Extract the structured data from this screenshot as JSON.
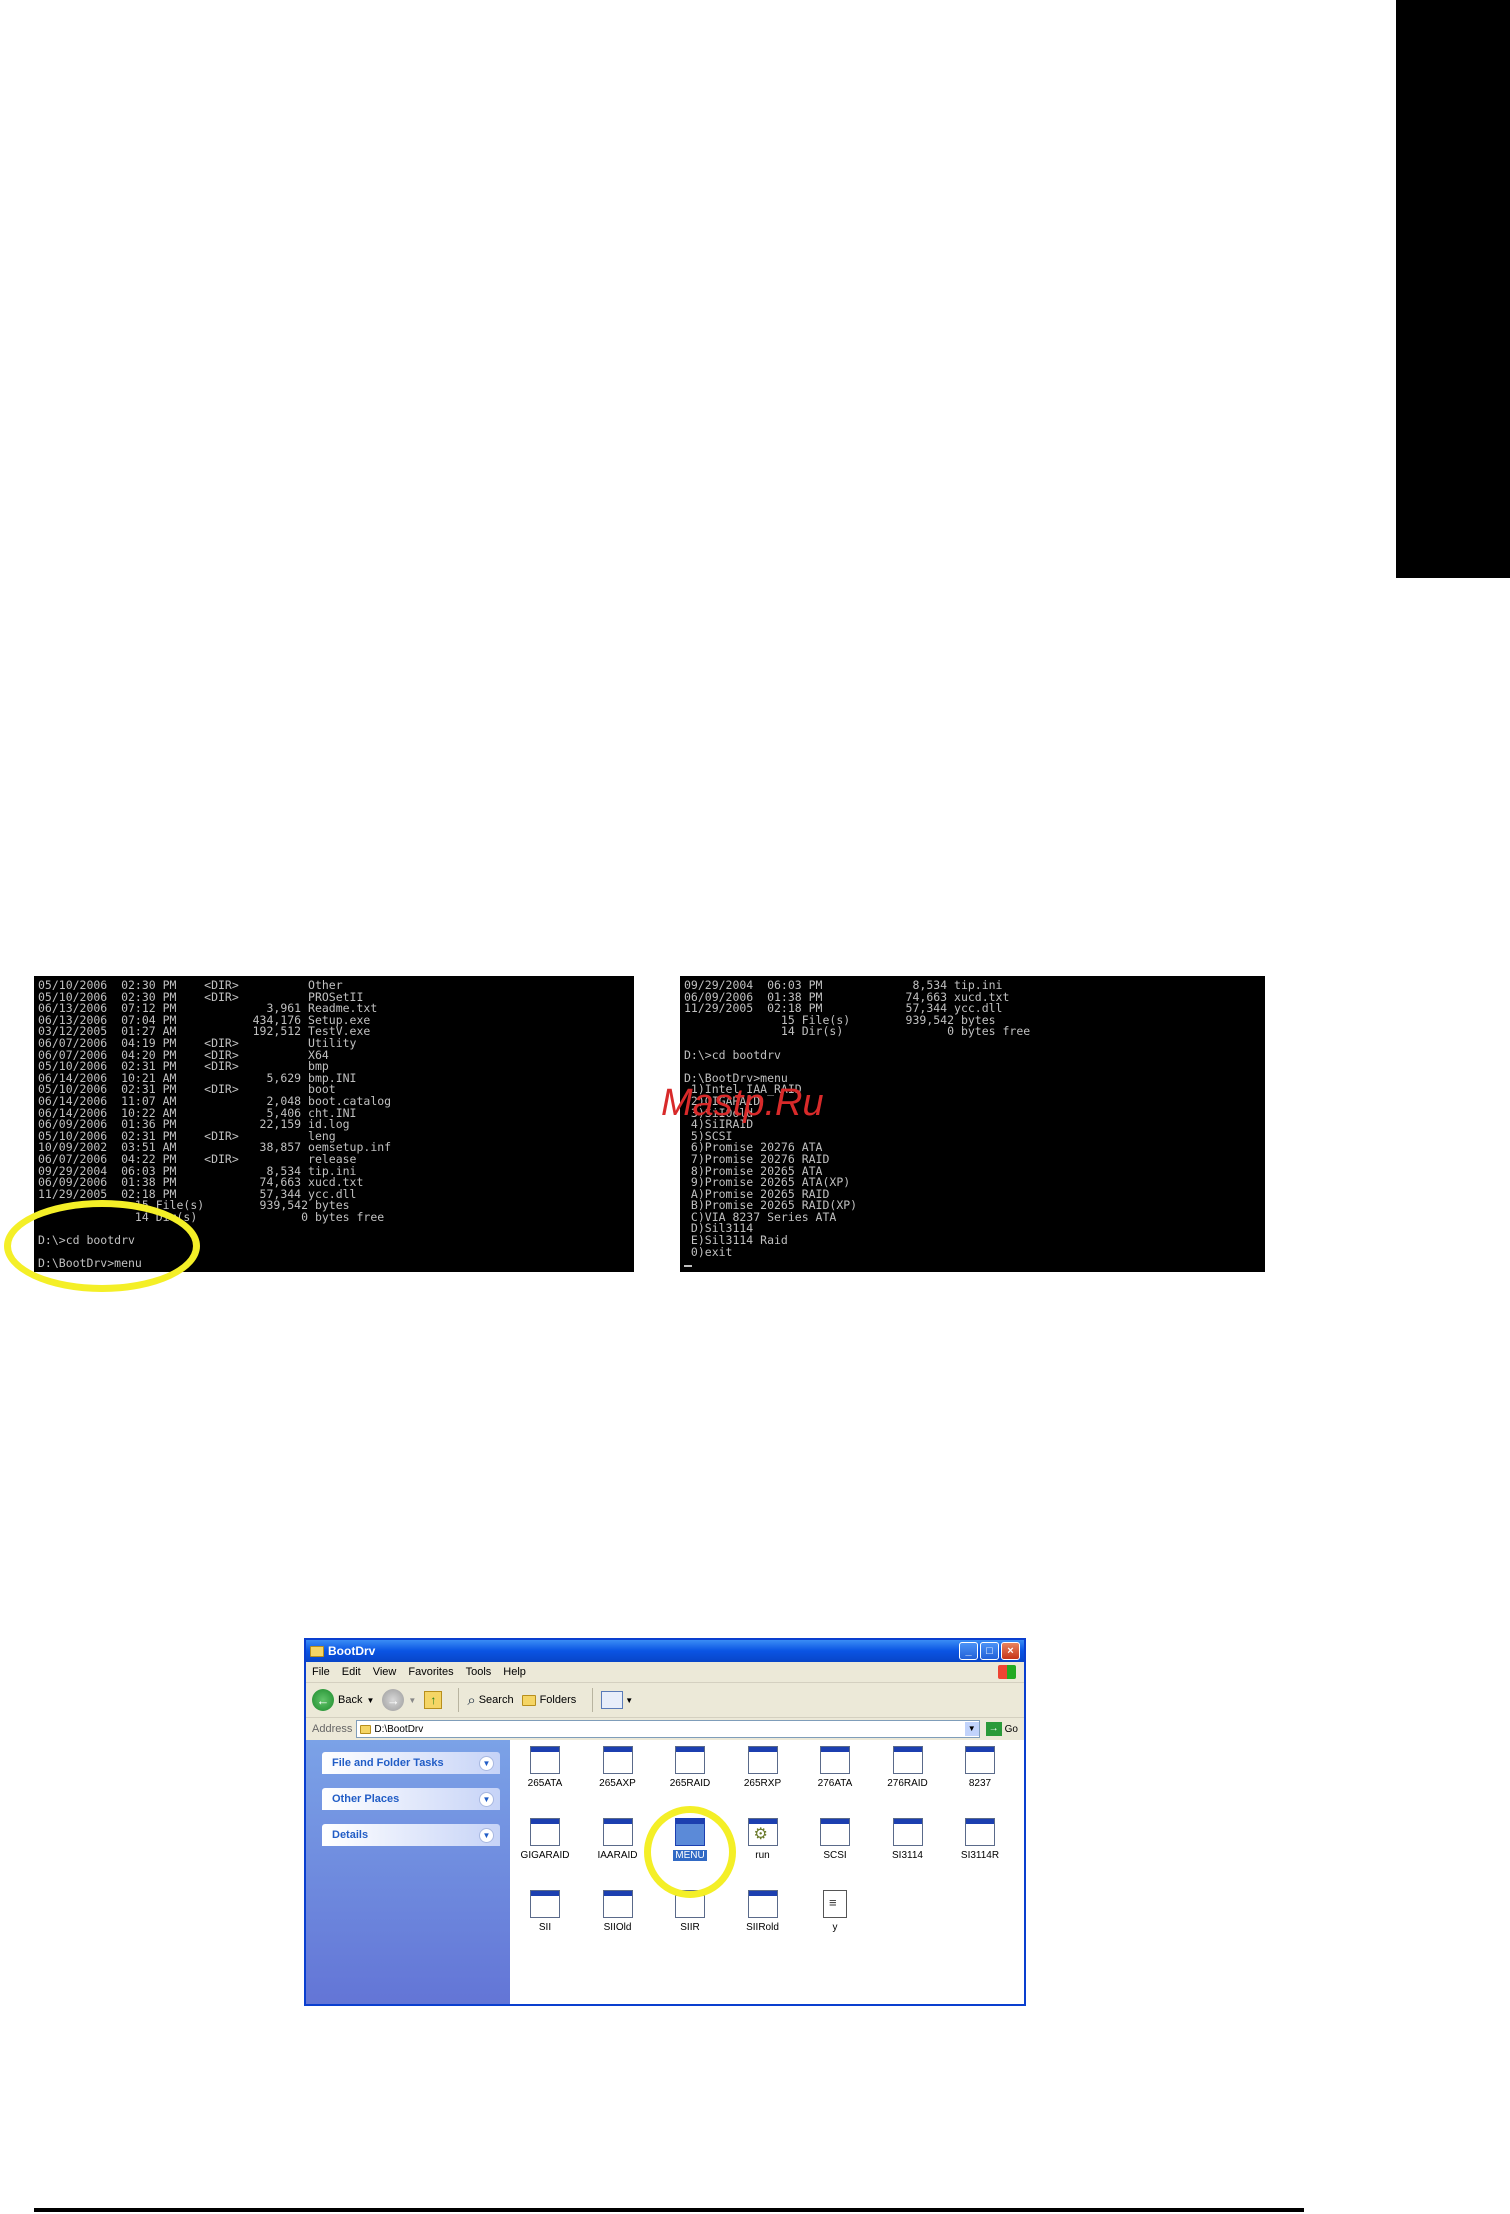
{
  "watermark": "Mastp.Ru",
  "console_left": {
    "lines": [
      "05/10/2006  02:30 PM    <DIR>          Other",
      "05/10/2006  02:30 PM    <DIR>          PROSetII",
      "06/13/2006  07:12 PM             3,961 Readme.txt",
      "06/13/2006  07:04 PM           434,176 Setup.exe",
      "03/12/2005  01:27 AM           192,512 TestV.exe",
      "06/07/2006  04:19 PM    <DIR>          Utility",
      "06/07/2006  04:20 PM    <DIR>          X64",
      "05/10/2006  02:31 PM    <DIR>          bmp",
      "06/14/2006  10:21 AM             5,629 bmp.INI",
      "05/10/2006  02:31 PM    <DIR>          boot",
      "06/14/2006  11:07 AM             2,048 boot.catalog",
      "06/14/2006  10:22 AM             5,406 cht.INI",
      "06/09/2006  01:36 PM            22,159 id.log",
      "05/10/2006  02:31 PM    <DIR>          leng",
      "10/09/2002  03:51 AM            38,857 oemsetup.inf",
      "06/07/2006  04:22 PM    <DIR>          release",
      "09/29/2004  06:03 PM             8,534 tip.ini",
      "06/09/2006  01:38 PM            74,663 xucd.txt",
      "11/29/2005  02:18 PM            57,344 ycc.dll",
      "              15 File(s)        939,542 bytes",
      "              14 Dir(s)               0 bytes free",
      "",
      "D:\\>cd bootdrv",
      "",
      "D:\\BootDrv>menu"
    ]
  },
  "console_right": {
    "lines": [
      "09/29/2004  06:03 PM             8,534 tip.ini",
      "06/09/2006  01:38 PM            74,663 xucd.txt",
      "11/29/2005  02:18 PM            57,344 ycc.dll",
      "              15 File(s)        939,542 bytes",
      "              14 Dir(s)               0 bytes free",
      "",
      "D:\\>cd bootdrv",
      "",
      "D:\\BootDrv>menu",
      " 1)Intel IAA_RAID",
      " 2)GIGARAID",
      " 3)SiI0old",
      " 4)SiIRAID",
      " 5)SCSI",
      " 6)Promise 20276 ATA",
      " 7)Promise 20276 RAID",
      " 8)Promise 20265 ATA",
      " 9)Promise 20265 ATA(XP)",
      " A)Promise 20265 RAID",
      " B)Promise 20265 RAID(XP)",
      " C)VIA 8237 Series ATA",
      " D)Sil3114",
      " E)Sil3114 Raid",
      " 0)exit"
    ]
  },
  "explorer": {
    "title": "BootDrv",
    "menu": [
      "File",
      "Edit",
      "View",
      "Favorites",
      "Tools",
      "Help"
    ],
    "toolbar": {
      "back": "Back",
      "search": "Search",
      "folders": "Folders"
    },
    "address_label": "Address",
    "address_value": "D:\\BootDrv",
    "go_label": "Go",
    "tasks": [
      "File and Folder Tasks",
      "Other Places",
      "Details"
    ],
    "files": [
      [
        "265ATA",
        "265AXP",
        "265RAID",
        "265RXP",
        "276ATA",
        "276RAID",
        "8237"
      ],
      [
        "GIGARAID",
        "IAARAID",
        "MENU",
        "run",
        "SCSI",
        "SI3114",
        "SI3114R"
      ],
      [
        "SII",
        "SIIOld",
        "SIIR",
        "SIIRold",
        "y"
      ]
    ],
    "selected_file": "MENU",
    "accent": "#0a54e3",
    "highlight": "#f4ef27"
  }
}
